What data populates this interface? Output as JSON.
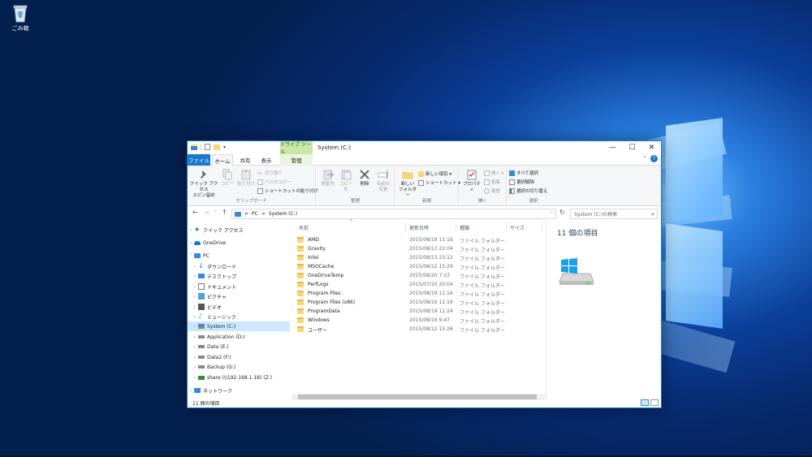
{
  "desktop": {
    "recycle_bin_label": "ごみ箱"
  },
  "window": {
    "title": "System (C:)",
    "tool_tab_group": "ドライブ ツール",
    "controls": [
      "—",
      "☐",
      "✕"
    ]
  },
  "ribbon_tabs": {
    "file": "ファイル",
    "home": "ホーム",
    "share": "共有",
    "view": "表示",
    "manage": "管理"
  },
  "ribbon": {
    "clipboard": {
      "pin_quick_access": "クイック アクセス",
      "pin_quick_access2": "スピン留め",
      "copy": "コピー",
      "paste": "貼り付け",
      "cut": "切り取り",
      "copy_path": "パスのコピー",
      "paste_shortcut": "ショートカットの貼り付け",
      "label": "クリップボード"
    },
    "organize": {
      "move_to": "移動先",
      "copy_to": "コピー先",
      "delete": "削除",
      "rename": "名前の",
      "rename2": "変更",
      "label": "整理"
    },
    "new": {
      "new_folder": "新しい",
      "new_folder2": "フォルダー",
      "new_item": "新しい項目 ▾",
      "shortcut": "ショートカット ▾",
      "label": "新規"
    },
    "open": {
      "properties": "プロパティ",
      "open": "開く ▾",
      "edit": "編集",
      "history": "履歴",
      "label": "開く"
    },
    "select": {
      "select_all": "すべて選択",
      "select_none": "選択解除",
      "invert": "選択の切り替え",
      "label": "選択"
    }
  },
  "address": {
    "path_pc": "PC",
    "path_sep": ">",
    "path_drive": "System (C:)",
    "search_placeholder": "System (C:)の検索"
  },
  "nav": [
    {
      "label": "クイック アクセス",
      "icon": "star-icon",
      "color": "#1979ca"
    },
    {
      "label": "OneDrive",
      "icon": "cloud-icon",
      "color": "#1979ca"
    },
    {
      "label": "PC",
      "icon": "monitor-icon",
      "color": "#3c88d8"
    },
    {
      "label": "ダウンロード",
      "icon": "download-icon",
      "color": "#1979ca"
    },
    {
      "label": "デスクトップ",
      "icon": "desktop-folder-icon",
      "color": "#3c88d8"
    },
    {
      "label": "ドキュメント",
      "icon": "document-icon",
      "color": "#777"
    },
    {
      "label": "ピクチャ",
      "icon": "picture-icon",
      "color": "#4aa3df"
    },
    {
      "label": "ビデオ",
      "icon": "video-icon",
      "color": "#555"
    },
    {
      "label": "ミュージック",
      "icon": "music-icon",
      "color": "#3c88d8"
    },
    {
      "label": "System (C:)",
      "icon": "system-drive-icon",
      "color": "#3c88d8"
    },
    {
      "label": "Application (D:)",
      "icon": "drive-icon",
      "color": "#777"
    },
    {
      "label": "Data (E:)",
      "icon": "drive-icon",
      "color": "#777"
    },
    {
      "label": "Data2 (F:)",
      "icon": "drive-icon",
      "color": "#777"
    },
    {
      "label": "Backup (G:)",
      "icon": "drive-icon",
      "color": "#777"
    },
    {
      "label": "share (\\\\192.168.1.18) (Z:)",
      "icon": "network-drive-icon",
      "color": "#3a8a3a"
    },
    {
      "label": "ネットワーク",
      "icon": "network-icon",
      "color": "#3c88d8"
    }
  ],
  "columns": {
    "name": "名前",
    "date": "更新日時",
    "type": "種類",
    "size": "サイズ"
  },
  "files": [
    {
      "name": "AMD",
      "date": "2015/08/19 11:16",
      "type": "ファイル フォルダー"
    },
    {
      "name": "Gravity",
      "date": "2015/08/13 22:04",
      "type": "ファイル フォルダー"
    },
    {
      "name": "Intel",
      "date": "2015/08/13 23:12",
      "type": "ファイル フォルダー"
    },
    {
      "name": "MSOCache",
      "date": "2015/08/12 15:29",
      "type": "ファイル フォルダー"
    },
    {
      "name": "OneDriveTemp",
      "date": "2015/08/20 7:23",
      "type": "ファイル フォルダー"
    },
    {
      "name": "PerfLogs",
      "date": "2015/07/10 20:04",
      "type": "ファイル フォルダー"
    },
    {
      "name": "Program Files",
      "date": "2015/08/19 11:16",
      "type": "ファイル フォルダー"
    },
    {
      "name": "Program Files (x86)",
      "date": "2015/08/19 11:16",
      "type": "ファイル フォルダー"
    },
    {
      "name": "ProgramData",
      "date": "2015/08/19 11:24",
      "type": "ファイル フォルダー"
    },
    {
      "name": "Windows",
      "date": "2015/08/19 9:47",
      "type": "ファイル フォルダー"
    },
    {
      "name": "ユーザー",
      "date": "2015/08/12 15:26",
      "type": "ファイル フォルダー"
    }
  ],
  "preview": {
    "title": "11 個の項目"
  },
  "status": {
    "count": "11 個の項目"
  }
}
